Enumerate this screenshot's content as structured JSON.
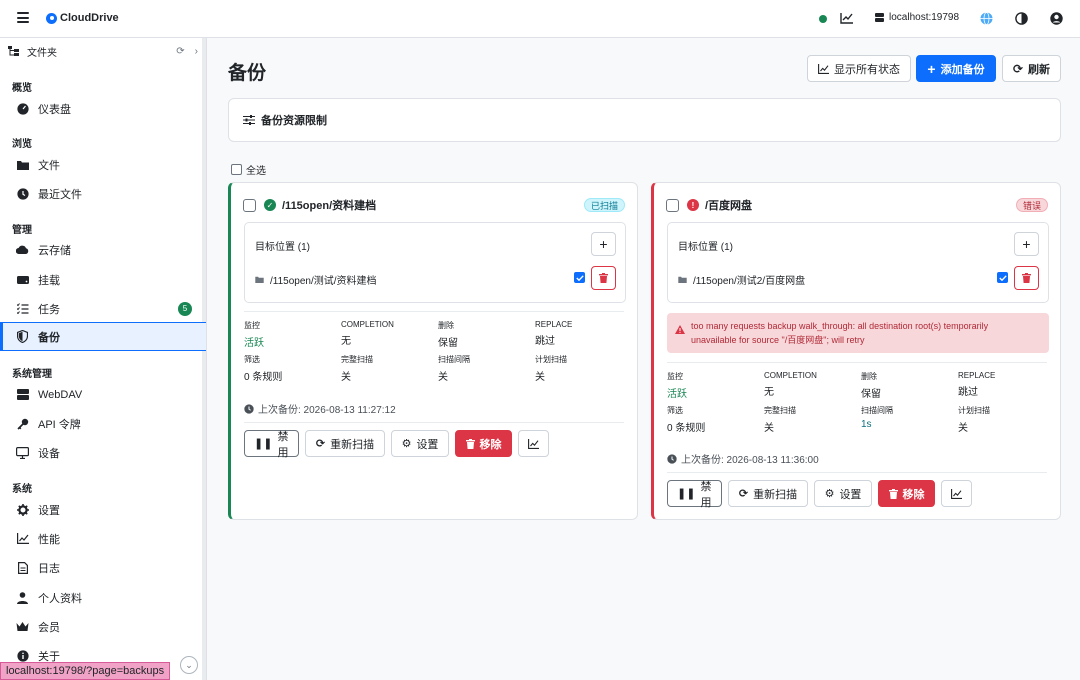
{
  "app": {
    "name": "CloudDrive",
    "server": "localhost:19798",
    "url_tip": "localhost:19798/?page=backups"
  },
  "sidebar": {
    "header": "文件夹",
    "sections": {
      "overview": "概览",
      "browse": "浏览",
      "manage": "管理",
      "sysmanage": "系统管理",
      "system": "系统"
    },
    "items": {
      "dashboard": "仪表盘",
      "files": "文件",
      "recent": "最近文件",
      "cloud": "云存储",
      "mount": "挂载",
      "tasks": "任务",
      "tasks_count": "5",
      "backup": "备份",
      "webdav": "WebDAV",
      "api": "API 令牌",
      "devices": "设备",
      "settings": "设置",
      "perf": "性能",
      "logs": "日志",
      "profile": "个人资料",
      "member": "会员",
      "about": "关于"
    }
  },
  "main": {
    "title": "备份",
    "btn_status": "显示所有状态",
    "btn_add": "添加备份",
    "btn_refresh": "刷新",
    "limit_title": "备份资源限制",
    "select_all": "全选"
  },
  "labels": {
    "targets": "目标位置 (1)",
    "monitor": "监控",
    "completion": "COMPLETION",
    "delete": "删除",
    "replace": "REPLACE",
    "filter": "筛选",
    "full_scan": "完整扫描",
    "scan_interval": "扫描间隔",
    "plan_scan": "计划扫描",
    "disable": "禁用",
    "rescan": "重新扫描",
    "settings": "设置",
    "remove": "移除"
  },
  "cards": [
    {
      "title": "/115open/资料建档",
      "status": "已扫描",
      "target_path": "/115open/测试/资料建档",
      "monitor": "活跃",
      "completion": "无",
      "delete": "保留",
      "replace": "跳过",
      "filter": "0 条规则",
      "full_scan": "关",
      "scan_interval": "关",
      "plan_scan": "关",
      "last_backup": "上次备份: 2026-08-13 11:27:12"
    },
    {
      "title": "/百度网盘",
      "status": "错误",
      "target_path": "/115open/测试2/百度网盘",
      "error_line1": "too many requests backup walk_through: all destination root(s) temporarily",
      "error_line2": "unavailable for source \"/百度网盘\"; will retry",
      "monitor": "活跃",
      "completion": "无",
      "delete": "保留",
      "replace": "跳过",
      "filter": "0 条规则",
      "full_scan": "关",
      "scan_interval": "1s",
      "plan_scan": "关",
      "last_backup": "上次备份: 2026-08-13 11:36:00"
    }
  ],
  "colors": {
    "primary": "#0d6efd",
    "success": "#198754",
    "danger": "#dc3545"
  }
}
